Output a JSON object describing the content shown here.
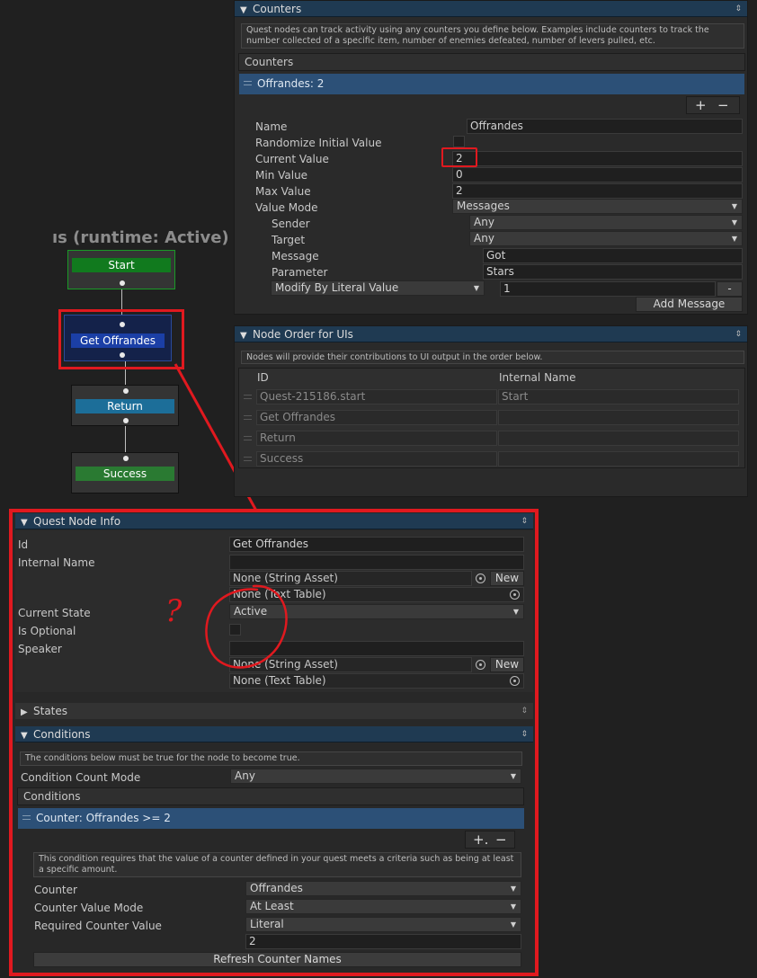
{
  "graph": {
    "title": "ıs (runtime: Active)",
    "nodes": [
      {
        "label": "Start",
        "color": "#117a1e"
      },
      {
        "label": "Get Offrandes",
        "color": "#1b3fa6"
      },
      {
        "label": "Return",
        "color": "#1c6e99"
      },
      {
        "label": "Success",
        "color": "#2a7a32"
      }
    ]
  },
  "counters_section": {
    "title": "Counters",
    "help": "Quest nodes can track activity using any counters you define below. Examples include counters to track the number collected of a specific item, number of enemies defeated, number of levers pulled, etc.",
    "list_header": "Counters",
    "selected_item": "Offrandes: 2",
    "add_label": "+",
    "remove_label": "−",
    "fields": {
      "name_label": "Name",
      "name_value": "Offrandes",
      "randomize_label": "Randomize Initial Value",
      "current_label": "Current Value",
      "current_value": "2",
      "min_label": "Min Value",
      "min_value": "0",
      "max_label": "Max Value",
      "max_value": "2",
      "mode_label": "Value Mode",
      "mode_value": "Messages",
      "sender_label": "Sender",
      "sender_value": "Any",
      "target_label": "Target",
      "target_value": "Any",
      "message_label": "Message",
      "message_value": "Got",
      "parameter_label": "Parameter",
      "parameter_value": "Stars",
      "modify_value": "Modify By Literal Value",
      "modify_amount": "1",
      "minus_label": "-",
      "add_message_label": "Add Message"
    }
  },
  "node_order": {
    "title": "Node Order for UIs",
    "help": "Nodes will provide their contributions to UI output in the order below.",
    "col_id": "ID",
    "col_internal": "Internal Name",
    "rows": [
      {
        "id": "Quest-215186.start",
        "internal": "Start"
      },
      {
        "id": "Get Offrandes",
        "internal": ""
      },
      {
        "id": "Return",
        "internal": ""
      },
      {
        "id": "Success",
        "internal": ""
      }
    ]
  },
  "node_info": {
    "title": "Quest Node Info",
    "id_label": "Id",
    "id_value": "Get Offrandes",
    "internal_label": "Internal Name",
    "internal_value": "",
    "string_asset": "None (String Asset)",
    "new_label": "New",
    "text_table": "None (Text Table)",
    "state_label": "Current State",
    "state_value": "Active",
    "optional_label": "Is Optional",
    "speaker_label": "Speaker",
    "speaker_value": "",
    "annotation": "?"
  },
  "states_section": {
    "title": "States"
  },
  "conditions": {
    "title": "Conditions",
    "help": "The conditions below must be true for the node to become true.",
    "count_mode_label": "Condition Count Mode",
    "count_mode_value": "Any",
    "list_header": "Conditions",
    "selected_item": "Counter: Offrandes >= 2",
    "add_label": "+.",
    "remove_label": "−",
    "desc": "This condition requires that the value of a counter defined in your quest meets a criteria such as being at least a specific amount.",
    "counter_label": "Counter",
    "counter_value": "Offrandes",
    "value_mode_label": "Counter Value Mode",
    "value_mode_value": "At Least",
    "required_label": "Required Counter Value",
    "required_value": "Literal",
    "required_amount": "2",
    "refresh_label": "Refresh Counter Names"
  },
  "colors": {
    "accent_red": "#e0191f",
    "header_blue": "#1f3a52",
    "selected_row": "#2c5077"
  }
}
